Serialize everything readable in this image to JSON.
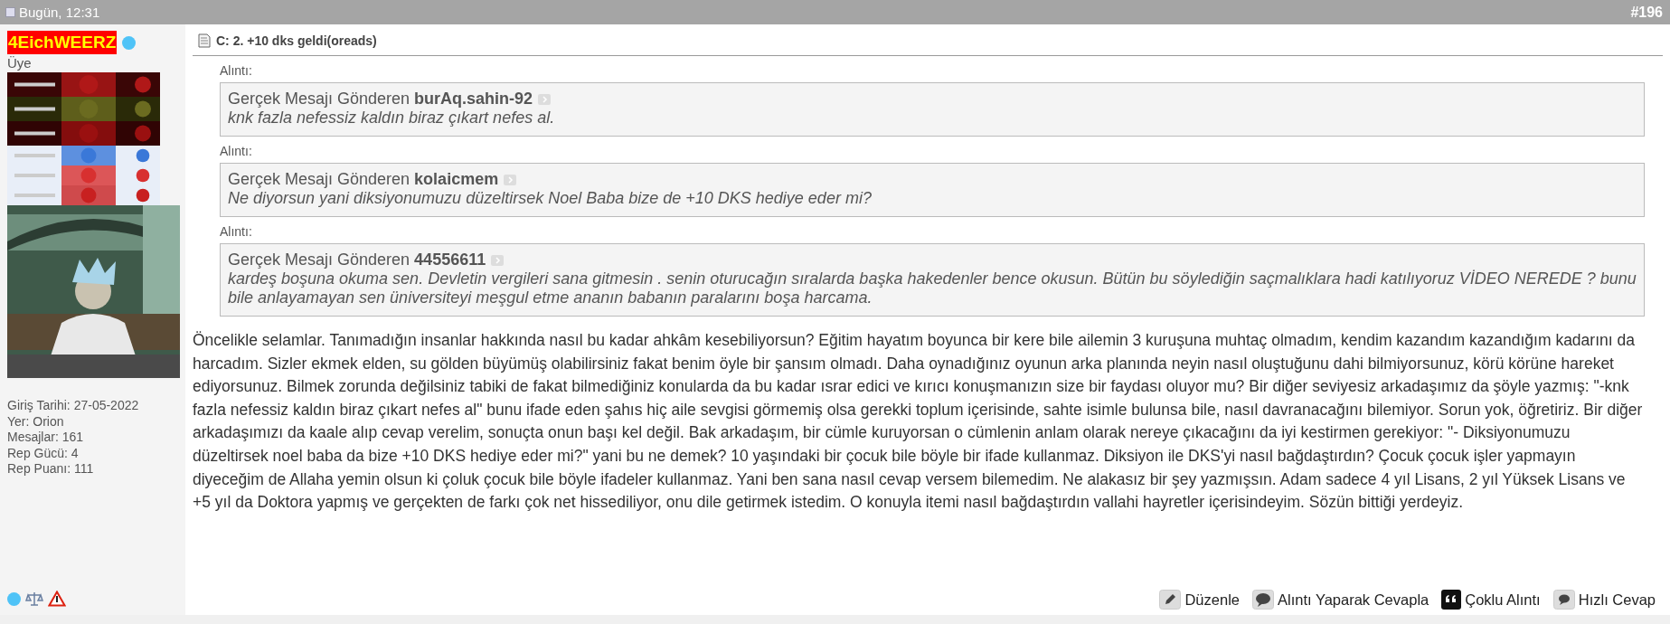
{
  "post": {
    "date": "Bugün, 12:31",
    "number": "#196"
  },
  "user": {
    "name": "4EichWEERZ",
    "online": true,
    "rank": "Üye",
    "stats": [
      "Giriş Tarihi: 27-05-2022",
      "Yer: Orion",
      "Mesajlar: 161",
      "Rep Gücü: 4",
      "Rep Puanı: 111"
    ]
  },
  "title": "C: 2. +10 dks geldi(oreads)",
  "quotes": [
    {
      "label": "Alıntı:",
      "prefix": "Gerçek Mesajı Gönderen",
      "author": "burAq.sahin-92",
      "text": "knk fazla nefessiz kaldın biraz çıkart nefes al."
    },
    {
      "label": "Alıntı:",
      "prefix": "Gerçek Mesajı Gönderen",
      "author": "kolaicmem",
      "text": "Ne diyorsun yani diksiyonumuzu düzeltirsek Noel Baba bize de +10 DKS hediye eder mi?"
    },
    {
      "label": "Alıntı:",
      "prefix": "Gerçek Mesajı Gönderen",
      "author": "44556611",
      "text": "kardeş boşuna okuma sen. Devletin vergileri sana gitmesin . senin oturucağın sıralarda başka hakedenler bence okusun. Bütün bu söylediğin saçmalıklara hadi katılıyoruz VİDEO NEREDE ? bunu bile anlayamayan sen üniversiteyi meşgul etme ananın babanın paralarını boşa harcama."
    }
  ],
  "body": "Öncelikle selamlar. Tanımadığın insanlar hakkında nasıl bu kadar ahkâm kesebiliyorsun? Eğitim hayatım boyunca bir kere bile ailemin 3 kuruşuna muhtaç olmadım, kendim kazandım kazandığım kadarını da harcadım. Sizler ekmek elden, su gölden büyümüş olabilirsiniz fakat benim öyle bir şansım olmadı. Daha oynadığınız oyunun arka planında neyin nasıl oluştuğunu dahi bilmiyorsunuz, körü körüne hareket ediyorsunuz. Bilmek zorunda değilsiniz tabiki de fakat bilmediğiniz konularda da bu kadar ısrar edici ve kırıcı konuşmanızın size bir faydası oluyor mu? Bir diğer seviyesiz arkadaşımız da şöyle yazmış: \"-knk fazla nefessiz kaldın biraz çıkart nefes al\" bunu ifade eden şahıs hiç aile sevgisi görmemiş olsa gerekki toplum içerisinde, sahte isimle bulunsa bile, nasıl davranacağını bilemiyor. Sorun yok, öğretiriz. Bir diğer arkadaşımızı da kaale alıp cevap verelim, sonuçta onun başı kel değil. Bak arkadaşım, bir cümle kuruyorsan o cümlenin anlam olarak nereye çıkacağını da iyi kestirmen gerekiyor: \"- Diksiyonumuzu düzeltirsek noel baba da bize +10 DKS hediye eder mi?\" yani bu ne demek? 10 yaşındaki bir çocuk bile böyle bir ifade kullanmaz. Diksiyon ile DKS'yi nasıl bağdaştırdın? Çocuk çocuk işler yapmayın diyeceğim de Allaha yemin olsun ki çoluk çocuk bile böyle ifadeler kullanmaz. Yani ben sana nasıl cevap versem bilemedim. Ne alakasız bir şey yazmışsın. Adam sadece 4 yıl Lisans, 2 yıl Yüksek Lisans ve +5 yıl da Doktora yapmış ve gerçekten de farkı çok net hissediliyor, onu dile getirmek istedim. O konuyla itemi nasıl bağdaştırdın vallahi hayretler içerisindeyim. Sözün bittiği yerdeyiz.",
  "actions": [
    {
      "kind": "edit",
      "label": "Düzenle"
    },
    {
      "kind": "quote",
      "label": "Alıntı Yaparak Cevapla"
    },
    {
      "kind": "multiquote",
      "label": "Çoklu Alıntı"
    },
    {
      "kind": "quickreply",
      "label": "Hızlı Cevap"
    }
  ]
}
